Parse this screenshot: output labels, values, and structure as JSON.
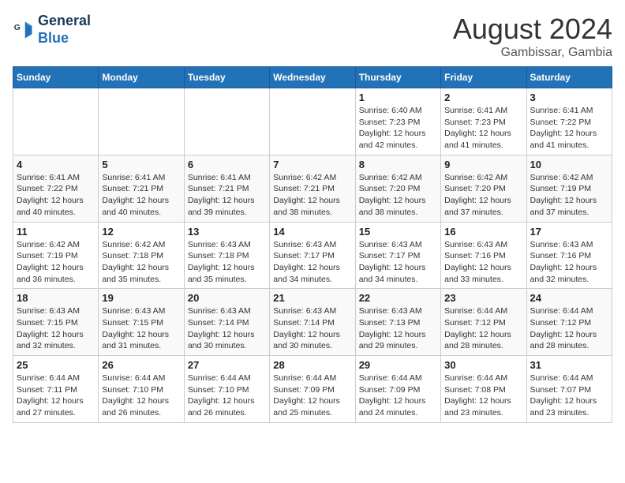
{
  "header": {
    "logo_line1": "General",
    "logo_line2": "Blue",
    "month_title": "August 2024",
    "location": "Gambissar, Gambia"
  },
  "weekdays": [
    "Sunday",
    "Monday",
    "Tuesday",
    "Wednesday",
    "Thursday",
    "Friday",
    "Saturday"
  ],
  "weeks": [
    [
      {
        "day": "",
        "sunrise": "",
        "sunset": "",
        "daylight": ""
      },
      {
        "day": "",
        "sunrise": "",
        "sunset": "",
        "daylight": ""
      },
      {
        "day": "",
        "sunrise": "",
        "sunset": "",
        "daylight": ""
      },
      {
        "day": "",
        "sunrise": "",
        "sunset": "",
        "daylight": ""
      },
      {
        "day": "1",
        "sunrise": "Sunrise: 6:40 AM",
        "sunset": "Sunset: 7:23 PM",
        "daylight": "Daylight: 12 hours and 42 minutes."
      },
      {
        "day": "2",
        "sunrise": "Sunrise: 6:41 AM",
        "sunset": "Sunset: 7:23 PM",
        "daylight": "Daylight: 12 hours and 41 minutes."
      },
      {
        "day": "3",
        "sunrise": "Sunrise: 6:41 AM",
        "sunset": "Sunset: 7:22 PM",
        "daylight": "Daylight: 12 hours and 41 minutes."
      }
    ],
    [
      {
        "day": "4",
        "sunrise": "Sunrise: 6:41 AM",
        "sunset": "Sunset: 7:22 PM",
        "daylight": "Daylight: 12 hours and 40 minutes."
      },
      {
        "day": "5",
        "sunrise": "Sunrise: 6:41 AM",
        "sunset": "Sunset: 7:21 PM",
        "daylight": "Daylight: 12 hours and 40 minutes."
      },
      {
        "day": "6",
        "sunrise": "Sunrise: 6:41 AM",
        "sunset": "Sunset: 7:21 PM",
        "daylight": "Daylight: 12 hours and 39 minutes."
      },
      {
        "day": "7",
        "sunrise": "Sunrise: 6:42 AM",
        "sunset": "Sunset: 7:21 PM",
        "daylight": "Daylight: 12 hours and 38 minutes."
      },
      {
        "day": "8",
        "sunrise": "Sunrise: 6:42 AM",
        "sunset": "Sunset: 7:20 PM",
        "daylight": "Daylight: 12 hours and 38 minutes."
      },
      {
        "day": "9",
        "sunrise": "Sunrise: 6:42 AM",
        "sunset": "Sunset: 7:20 PM",
        "daylight": "Daylight: 12 hours and 37 minutes."
      },
      {
        "day": "10",
        "sunrise": "Sunrise: 6:42 AM",
        "sunset": "Sunset: 7:19 PM",
        "daylight": "Daylight: 12 hours and 37 minutes."
      }
    ],
    [
      {
        "day": "11",
        "sunrise": "Sunrise: 6:42 AM",
        "sunset": "Sunset: 7:19 PM",
        "daylight": "Daylight: 12 hours and 36 minutes."
      },
      {
        "day": "12",
        "sunrise": "Sunrise: 6:42 AM",
        "sunset": "Sunset: 7:18 PM",
        "daylight": "Daylight: 12 hours and 35 minutes."
      },
      {
        "day": "13",
        "sunrise": "Sunrise: 6:43 AM",
        "sunset": "Sunset: 7:18 PM",
        "daylight": "Daylight: 12 hours and 35 minutes."
      },
      {
        "day": "14",
        "sunrise": "Sunrise: 6:43 AM",
        "sunset": "Sunset: 7:17 PM",
        "daylight": "Daylight: 12 hours and 34 minutes."
      },
      {
        "day": "15",
        "sunrise": "Sunrise: 6:43 AM",
        "sunset": "Sunset: 7:17 PM",
        "daylight": "Daylight: 12 hours and 34 minutes."
      },
      {
        "day": "16",
        "sunrise": "Sunrise: 6:43 AM",
        "sunset": "Sunset: 7:16 PM",
        "daylight": "Daylight: 12 hours and 33 minutes."
      },
      {
        "day": "17",
        "sunrise": "Sunrise: 6:43 AM",
        "sunset": "Sunset: 7:16 PM",
        "daylight": "Daylight: 12 hours and 32 minutes."
      }
    ],
    [
      {
        "day": "18",
        "sunrise": "Sunrise: 6:43 AM",
        "sunset": "Sunset: 7:15 PM",
        "daylight": "Daylight: 12 hours and 32 minutes."
      },
      {
        "day": "19",
        "sunrise": "Sunrise: 6:43 AM",
        "sunset": "Sunset: 7:15 PM",
        "daylight": "Daylight: 12 hours and 31 minutes."
      },
      {
        "day": "20",
        "sunrise": "Sunrise: 6:43 AM",
        "sunset": "Sunset: 7:14 PM",
        "daylight": "Daylight: 12 hours and 30 minutes."
      },
      {
        "day": "21",
        "sunrise": "Sunrise: 6:43 AM",
        "sunset": "Sunset: 7:14 PM",
        "daylight": "Daylight: 12 hours and 30 minutes."
      },
      {
        "day": "22",
        "sunrise": "Sunrise: 6:43 AM",
        "sunset": "Sunset: 7:13 PM",
        "daylight": "Daylight: 12 hours and 29 minutes."
      },
      {
        "day": "23",
        "sunrise": "Sunrise: 6:44 AM",
        "sunset": "Sunset: 7:12 PM",
        "daylight": "Daylight: 12 hours and 28 minutes."
      },
      {
        "day": "24",
        "sunrise": "Sunrise: 6:44 AM",
        "sunset": "Sunset: 7:12 PM",
        "daylight": "Daylight: 12 hours and 28 minutes."
      }
    ],
    [
      {
        "day": "25",
        "sunrise": "Sunrise: 6:44 AM",
        "sunset": "Sunset: 7:11 PM",
        "daylight": "Daylight: 12 hours and 27 minutes."
      },
      {
        "day": "26",
        "sunrise": "Sunrise: 6:44 AM",
        "sunset": "Sunset: 7:10 PM",
        "daylight": "Daylight: 12 hours and 26 minutes."
      },
      {
        "day": "27",
        "sunrise": "Sunrise: 6:44 AM",
        "sunset": "Sunset: 7:10 PM",
        "daylight": "Daylight: 12 hours and 26 minutes."
      },
      {
        "day": "28",
        "sunrise": "Sunrise: 6:44 AM",
        "sunset": "Sunset: 7:09 PM",
        "daylight": "Daylight: 12 hours and 25 minutes."
      },
      {
        "day": "29",
        "sunrise": "Sunrise: 6:44 AM",
        "sunset": "Sunset: 7:09 PM",
        "daylight": "Daylight: 12 hours and 24 minutes."
      },
      {
        "day": "30",
        "sunrise": "Sunrise: 6:44 AM",
        "sunset": "Sunset: 7:08 PM",
        "daylight": "Daylight: 12 hours and 23 minutes."
      },
      {
        "day": "31",
        "sunrise": "Sunrise: 6:44 AM",
        "sunset": "Sunset: 7:07 PM",
        "daylight": "Daylight: 12 hours and 23 minutes."
      }
    ]
  ]
}
